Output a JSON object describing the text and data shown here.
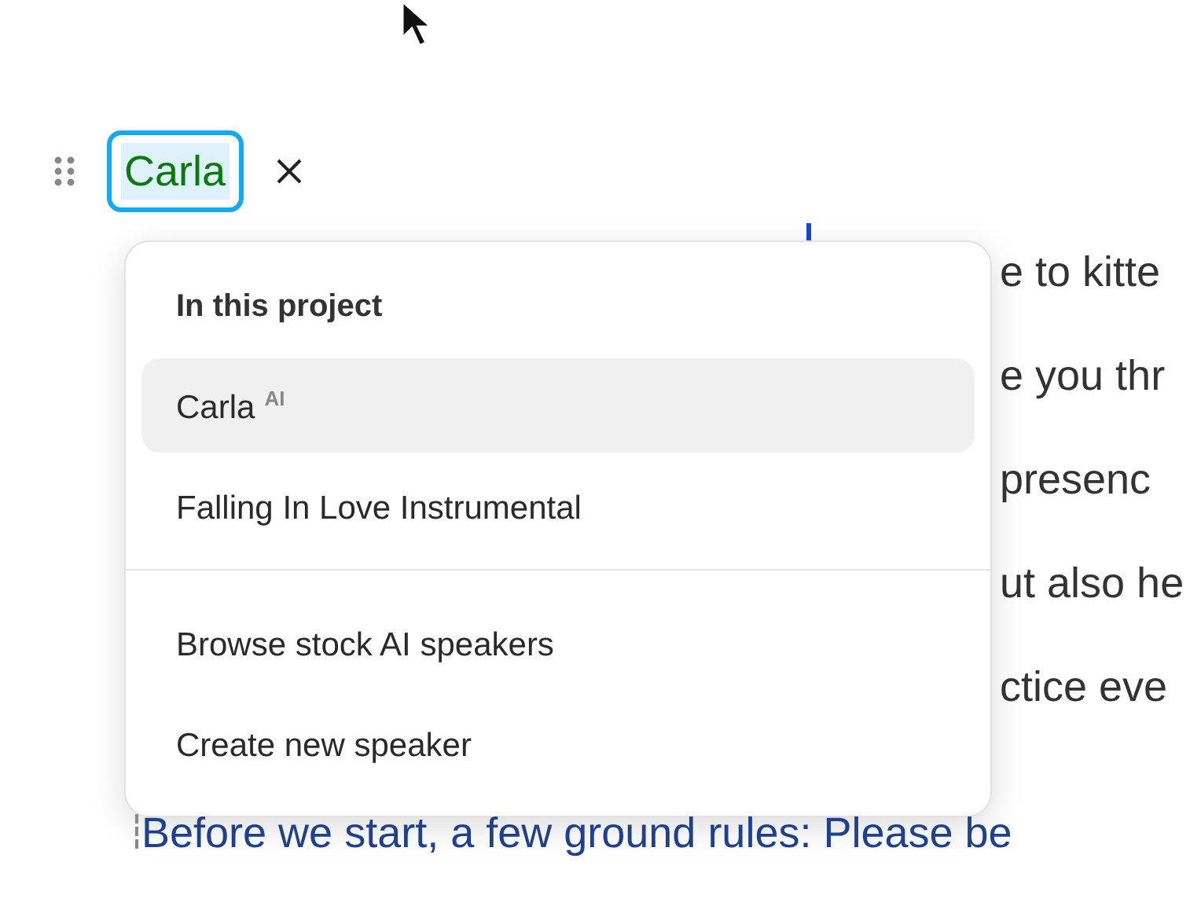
{
  "speaker_chip": {
    "label": "Carla",
    "focused": true
  },
  "background_lines": [
    "e to kitte",
    "e you thr",
    "presenc",
    "ut also he",
    "ctice eve"
  ],
  "menu": {
    "heading": "In this project",
    "items": [
      {
        "kind": "option",
        "label": "Carla",
        "badge": "AI",
        "selected": true
      },
      {
        "kind": "option",
        "label": "Falling In Love Instrumental",
        "selected": false
      },
      {
        "kind": "divider"
      },
      {
        "kind": "option",
        "label": "Browse stock AI speakers",
        "selected": false
      },
      {
        "kind": "option",
        "label": "Create new speaker",
        "selected": false
      }
    ]
  },
  "next_line": "Before we start, a few ground rules: Please be"
}
